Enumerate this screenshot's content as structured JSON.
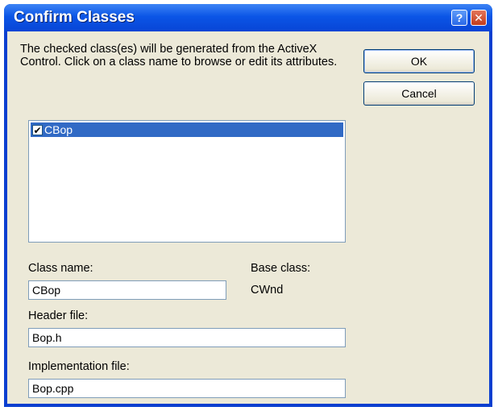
{
  "dialog": {
    "title": "Confirm Classes",
    "help_symbol": "?",
    "close_symbol": "✕"
  },
  "description": "The checked class(es) will be generated from the ActiveX Control.  Click on a class name to browse or edit its attributes.",
  "buttons": {
    "ok_label": "OK",
    "cancel_label": "Cancel"
  },
  "class_list": {
    "items": [
      {
        "label": "CBop",
        "checked": true,
        "check_symbol": "✔"
      }
    ]
  },
  "fields": {
    "class_name_label": "Class name:",
    "class_name_value": "CBop",
    "base_class_label": "Base class:",
    "base_class_value": "CWnd",
    "header_file_label": "Header file:",
    "header_file_value": "Bop.h",
    "impl_file_label": "Implementation file:",
    "impl_file_value": "Bop.cpp"
  }
}
